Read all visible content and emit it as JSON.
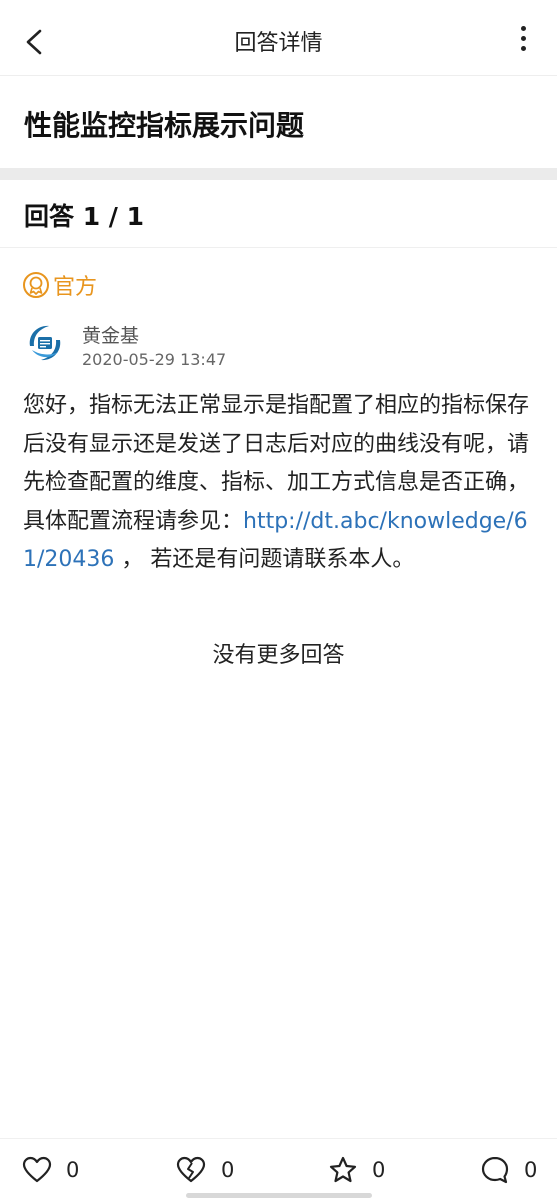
{
  "header": {
    "title": "回答详情"
  },
  "question": {
    "title": "性能监控指标展示问题"
  },
  "answers": {
    "count_label": "回答 1 / 1"
  },
  "answer": {
    "badge": "官方",
    "author": "黄金基",
    "time": "2020-05-29 13:47",
    "text_before_link": "您好，指标无法正常显示是指配置了相应的指标保存后没有显示还是发送了日志后对应的曲线没有呢，请先检查配置的维度、指标、加工方式信息是否正确，具体配置流程请参见：",
    "link": "http://dt.abc/knowledge/61/20436",
    "text_after_link": " ， 若还是有问题请联系本人。"
  },
  "footer_note": "没有更多回答",
  "actions": {
    "like_count": "0",
    "dislike_count": "0",
    "favorite_count": "0",
    "comment_count": "0"
  },
  "colors": {
    "accent": "#e8951e",
    "link": "#2d72b8",
    "avatar": "#1b6fa8"
  }
}
